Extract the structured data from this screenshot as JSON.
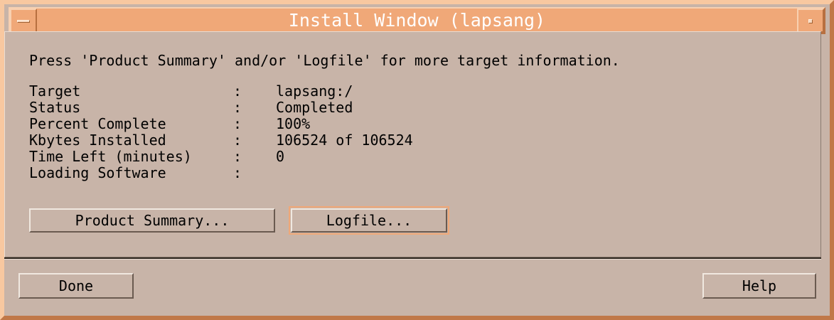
{
  "window": {
    "title": "Install Window (lapsang)",
    "accent_color": "#f0a878",
    "background_color": "#c8b4a8"
  },
  "hint": "Press 'Product Summary' and/or 'Logfile' for more target information.",
  "info": [
    {
      "label": "Target",
      "colon": ":",
      "value": "lapsang:/"
    },
    {
      "label": "Status",
      "colon": ":",
      "value": "Completed"
    },
    {
      "label": "Percent Complete",
      "colon": ":",
      "value": "100%"
    },
    {
      "label": "Kbytes Installed",
      "colon": ":",
      "value": "106524 of 106524"
    },
    {
      "label": "Time Left (minutes)",
      "colon": ":",
      "value": "0"
    },
    {
      "label": "Loading Software",
      "colon": ":",
      "value": ""
    }
  ],
  "buttons": {
    "product_summary": "Product Summary...",
    "logfile": "Logfile...",
    "done": "Done",
    "help": "Help"
  },
  "icons": {
    "window_menu": "window-menu-icon",
    "minimize": "minimize-icon"
  }
}
